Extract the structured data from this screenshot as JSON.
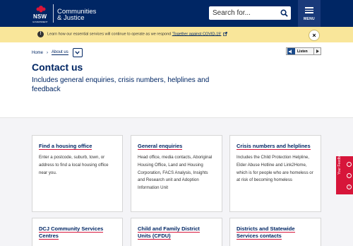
{
  "header": {
    "logo_text": "NSW",
    "logo_subtext": "GOVERNMENT",
    "agency_line1": "Communities",
    "agency_line2": "& Justice",
    "search_placeholder": "Search for...",
    "menu_label": "MENU"
  },
  "alert": {
    "text_before": "Learn how our essential services will continue to operate as we respond ",
    "link_text": "'Together against COVID-19'",
    "close_symbol": "×"
  },
  "breadcrumb": {
    "home": "Home",
    "separator": "›",
    "current": "About us"
  },
  "listen": {
    "label": "Listen"
  },
  "page": {
    "title": "Contact us",
    "subtitle": "Includes general enquiries, crisis numbers, helplines and feedback"
  },
  "cards": [
    {
      "title": "Find a housing office",
      "body": "Enter a postcode, suburb, town, or address to find a local housing office near you."
    },
    {
      "title": "General enquiries",
      "body": "Head office, media contacts, Aboriginal Housing Office, Land and Housing Corporation, FACS Analysis, Insights and Research unit and Adoption Information Unit"
    },
    {
      "title": "Crisis numbers and helplines",
      "body": "Includes the Child Protection Helpline, Elder Abuse Hotline and Link2Home, which is for people who are homeless or at risk of becoming homeless"
    },
    {
      "title_line1": "DCJ Community Services",
      "title_line2": "Centres"
    },
    {
      "title_line1": "Child and Family District",
      "title_line2": "Units (CFDU)"
    },
    {
      "title_line1": "Districts and Statewide",
      "title_line2": "Services contacts"
    }
  ],
  "feedback": {
    "label": "Your Feedback"
  },
  "colors": {
    "brand_navy": "#002664",
    "accent_red": "#d7153a",
    "alert_yellow": "#f9e69a"
  }
}
